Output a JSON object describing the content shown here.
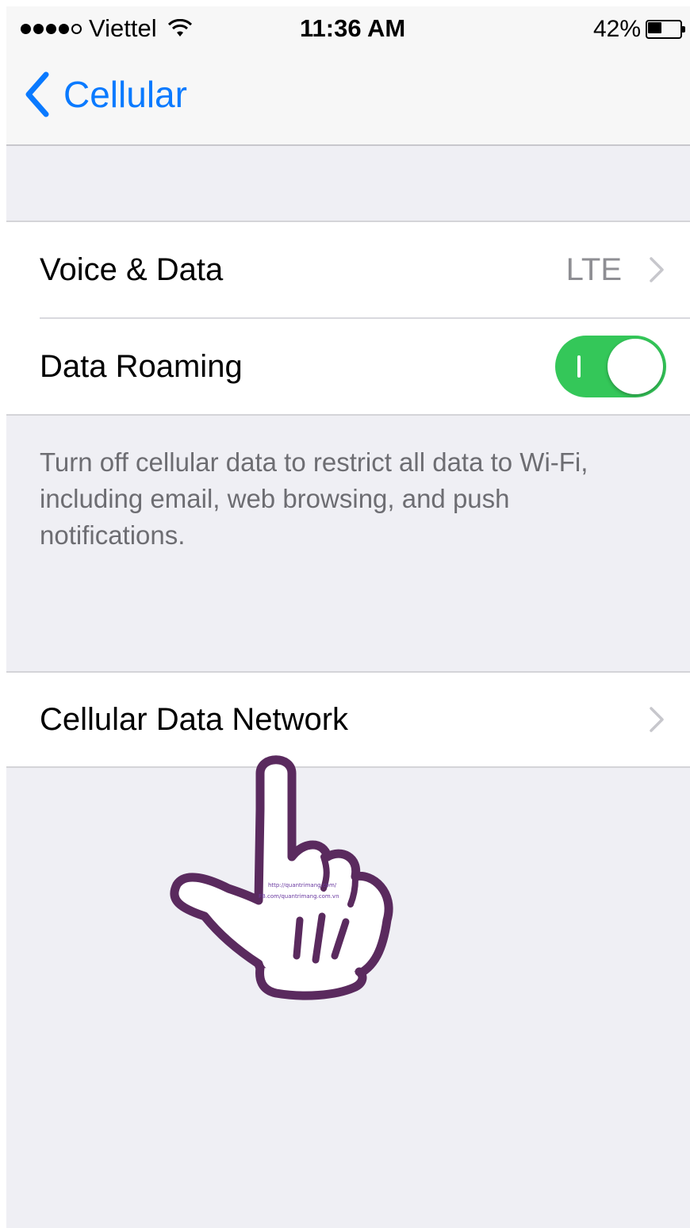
{
  "status_bar": {
    "carrier": "Viettel",
    "time": "11:36 AM",
    "battery": "42%",
    "battery_level": 0.42,
    "signal_bars": 4
  },
  "nav": {
    "back_label": "Cellular",
    "back_icon": "chevron-left-icon"
  },
  "section1": {
    "voice_data_label": "Voice & Data",
    "voice_data_value": "LTE",
    "data_roaming_label": "Data Roaming",
    "data_roaming_on": true
  },
  "footer": {
    "text": "Turn off cellular data to restrict all data to Wi-Fi, including email, web browsing, and push notifications."
  },
  "section2": {
    "cellular_data_network_label": "Cellular Data Network"
  },
  "overlay": {
    "hand_icon": "pointing-hand-icon",
    "hand_text_1": "http://quantrimang.com/",
    "hand_text_2": "FB.com/quantrimang.com.vn"
  },
  "colors": {
    "accent": "#0a7aff",
    "toggle_on": "#34c759",
    "background": "#efeff4",
    "hand_outline": "#5a2a5e"
  }
}
